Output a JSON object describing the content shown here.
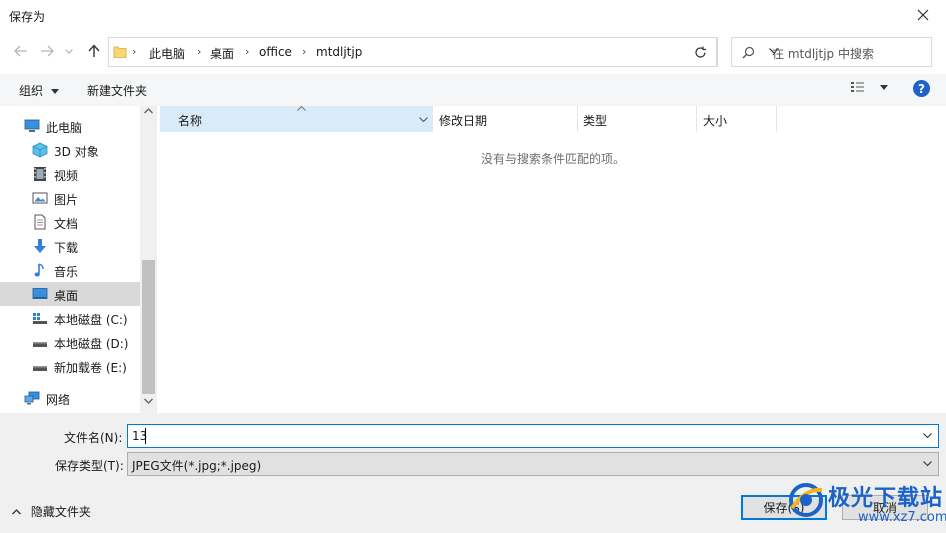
{
  "window": {
    "title": "保存为"
  },
  "address": {
    "crumbs": [
      "此电脑",
      "桌面",
      "office",
      "mtdljtjp"
    ]
  },
  "search": {
    "placeholder": "在 mtdljtjp 中搜索"
  },
  "toolbar": {
    "organize": "组织",
    "new_folder": "新建文件夹",
    "help": "?"
  },
  "sidebar": {
    "items": [
      {
        "label": "此电脑",
        "icon": "computer-icon"
      },
      {
        "label": "3D 对象",
        "icon": "cube-icon"
      },
      {
        "label": "视频",
        "icon": "video-icon"
      },
      {
        "label": "图片",
        "icon": "picture-icon"
      },
      {
        "label": "文档",
        "icon": "document-icon"
      },
      {
        "label": "下载",
        "icon": "download-icon"
      },
      {
        "label": "音乐",
        "icon": "music-icon"
      },
      {
        "label": "桌面",
        "icon": "desktop-icon"
      },
      {
        "label": "本地磁盘 (C:)",
        "icon": "drive-c-icon"
      },
      {
        "label": "本地磁盘 (D:)",
        "icon": "drive-icon"
      },
      {
        "label": "新加载卷 (E:)",
        "icon": "drive-icon"
      },
      {
        "label": "网络",
        "icon": "network-icon"
      }
    ]
  },
  "columns": {
    "name": "名称",
    "modified": "修改日期",
    "type": "类型",
    "size": "大小"
  },
  "content": {
    "empty_message": "没有与搜索条件匹配的项。"
  },
  "form": {
    "filename_label": "文件名(N):",
    "filename_value": "13",
    "filetype_label": "保存类型(T):",
    "filetype_value": "JPEG文件(*.jpg;*.jpeg)"
  },
  "footer": {
    "hide_folders": "隐藏文件夹",
    "save": "保存(S)",
    "cancel": "取消"
  },
  "watermark": {
    "brand": "极光下载站",
    "url": "www.xz7.com"
  }
}
